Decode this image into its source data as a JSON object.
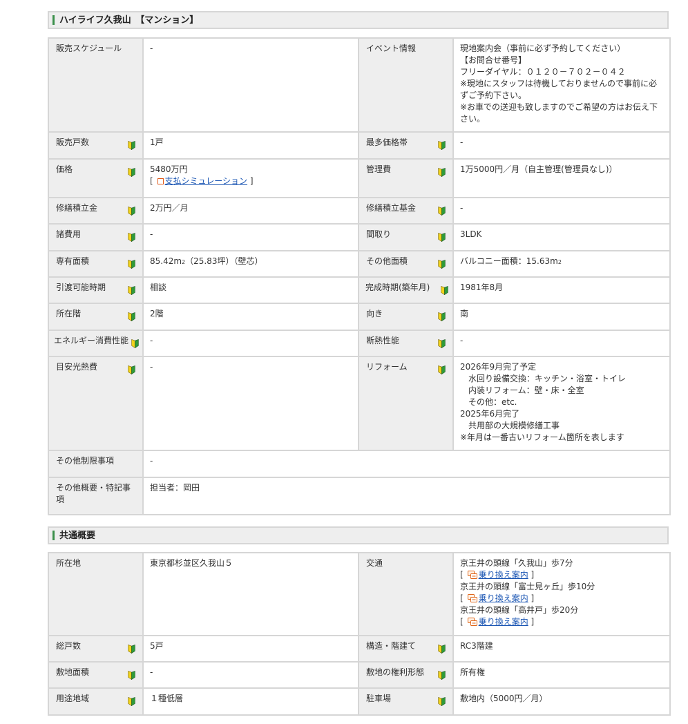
{
  "section1": {
    "title": "ハイライフ久我山　【マンション】",
    "schedule_label": "販売スケジュール",
    "schedule_value": "-",
    "event_label": "イベント情報",
    "event_lines": [
      "現地案内会（事前に必ず予約してください）",
      "【お問合せ番号】",
      "フリーダイヤル：０１２０－７０２－０４２",
      "※現地にスタッフは待機しておりませんので事前に必",
      "ずご予約下さい。",
      "※お車での送迎も致しますのでご希望の方はお伝え下",
      "さい。"
    ],
    "units_label": "販売戸数",
    "units_value": "1戸",
    "price_band_label": "最多価格帯",
    "price_band_value": "-",
    "price_label": "価格",
    "price_value": "5480万円",
    "bracket_open": "[",
    "bracket_close": "]",
    "sim_link": "支払シミュレーション",
    "mgmt_label": "管理費",
    "mgmt_value": "1万5000円／月（自主管理(管理員なし)）",
    "repair_label": "修繕積立金",
    "repair_value": "2万円／月",
    "repair_fund_label": "修繕積立基金",
    "repair_fund_value": "-",
    "fees_label": "諸費用",
    "fees_value": "-",
    "layout_label": "間取り",
    "layout_value": "3LDK",
    "area_label": "専有面積",
    "area_num": "85.42m",
    "area_unit": "2",
    "area_rest": "（25.83坪）（壁芯）",
    "other_area_label": "その他面積",
    "other_area_num": "バルコニー面積：15.63m",
    "other_area_unit": "2",
    "handover_label": "引渡可能時期",
    "handover_value": "相談",
    "built_label": "完成時期(築年月)",
    "built_value": "1981年8月",
    "floor_label": "所在階",
    "floor_value": "2階",
    "direction_label": "向き",
    "direction_value": "南",
    "energy_label": "エネルギー消費性能",
    "energy_value": "-",
    "insulation_label": "断熱性能",
    "insulation_value": "-",
    "utility_label": "目安光熱費",
    "utility_value": "-",
    "reform_label": "リフォーム",
    "reform_lines": [
      {
        "text": "2026年9月完了予定",
        "indent": false
      },
      {
        "text": "水回り設備交換：キッチン・浴室・トイレ",
        "indent": true
      },
      {
        "text": "内装リフォーム：壁・床・全室",
        "indent": true
      },
      {
        "text": "その他：etc.",
        "indent": true
      },
      {
        "text": "2025年6月完了",
        "indent": false
      },
      {
        "text": "共用部の大規模修繕工事",
        "indent": true
      },
      {
        "text": "※年月は一番古いリフォーム箇所を表します",
        "indent": false
      }
    ],
    "restrict_label": "その他制限事項",
    "restrict_value": "-",
    "notes_label": "その他概要・特記事項",
    "notes_value": "担当者：岡田"
  },
  "section2": {
    "title": "共通概要",
    "location_label": "所在地",
    "location_value": "東京都杉並区久我山５",
    "transport_label": "交通",
    "transport": [
      {
        "line": "京王井の頭線「久我山」歩7分",
        "link": "乗り換え案内"
      },
      {
        "line": "京王井の頭線「富士見ヶ丘」歩10分",
        "link": "乗り換え案内"
      },
      {
        "line": "京王井の頭線「高井戸」歩20分",
        "link": "乗り換え案内"
      }
    ],
    "total_units_label": "総戸数",
    "total_units_value": "5戸",
    "structure_label": "構造・階建て",
    "structure_value": "RC3階建",
    "land_area_label": "敷地面積",
    "land_area_value": "-",
    "land_rights_label": "敷地の権利形態",
    "land_rights_value": "所有権",
    "zoning_label": "用途地域",
    "zoning_value": "１種低層",
    "parking_label": "駐車場",
    "parking_value": "敷地内（5000円／月）"
  },
  "colors": {
    "header_bg": "#eeeeee",
    "accent_green": "#3a8f4a",
    "border": "#d6d6d6",
    "link": "#1a55b3",
    "beginner_yellow": "#f2d21b",
    "beginner_green": "#2f9a3a"
  },
  "icons": {
    "help": "beginner-mark-icon",
    "simulation": "square-icon",
    "transfer": "train-transfer-icon"
  }
}
